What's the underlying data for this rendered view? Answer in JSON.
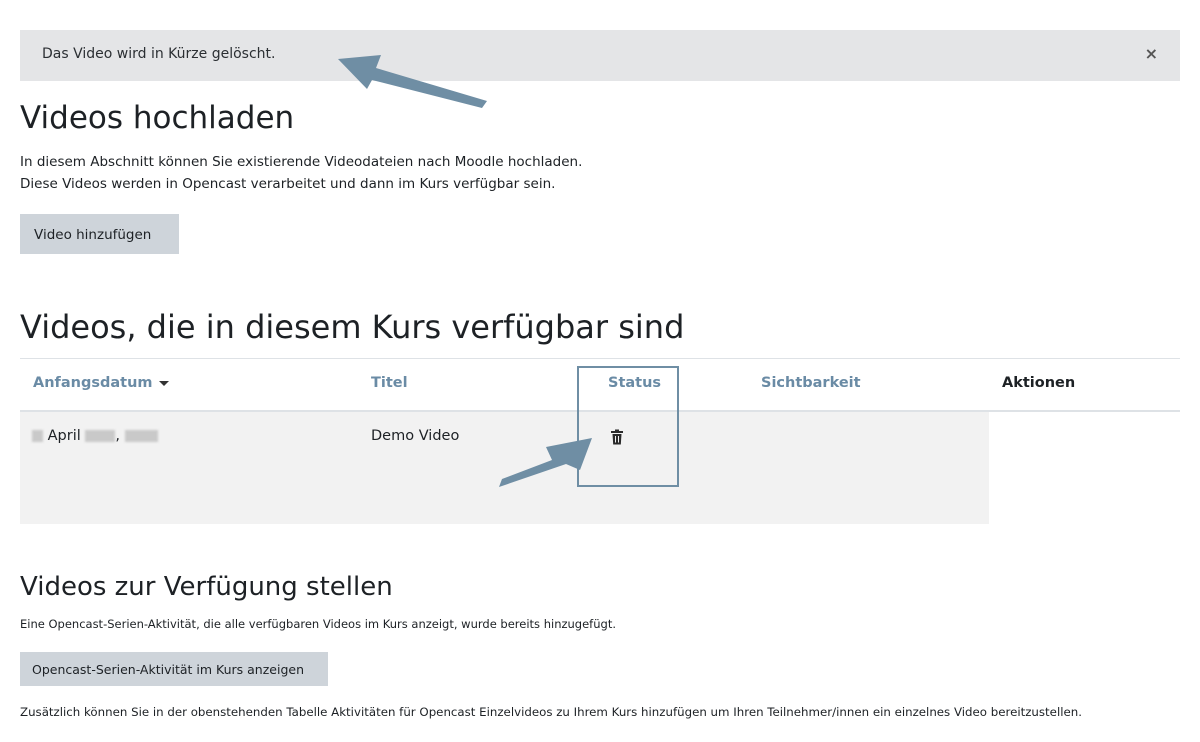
{
  "alert": {
    "text": "Das Video wird in Kürze gelöscht.",
    "close_symbol": "×"
  },
  "upload": {
    "heading": "Videos hochladen",
    "line1": "In diesem Abschnitt können Sie existierende Videodateien nach Moodle hochladen.",
    "line2": "Diese Videos werden in Opencast verarbeitet und dann im Kurs verfügbar sein.",
    "add_button": "Video hinzufügen"
  },
  "available": {
    "heading": "Videos, die in diesem Kurs verfügbar sind",
    "columns": [
      "Anfangsdatum",
      "Titel",
      "Status",
      "Sichtbarkeit",
      "Aktionen"
    ],
    "rows": [
      {
        "date_month": "April",
        "title": "Demo Video",
        "status_icon": "trash-icon"
      }
    ]
  },
  "provide": {
    "heading": "Videos zur Verfügung stellen",
    "text": "Eine Opencast-Serien-Aktivität, die alle verfügbaren Videos im Kurs anzeigt, wurde bereits hinzugefügt.",
    "button": "Opencast-Serien-Aktivität im Kurs anzeigen",
    "footer": "Zusätzlich können Sie in der obenstehenden Tabelle Aktivitäten für Opencast Einzelvideos zu Ihrem Kurs hinzufügen um Ihren Teilnehmer/innen ein einzelnes Video bereitzustellen."
  },
  "colors": {
    "link": "#6a8ba5",
    "annotation": "#6f8ea4",
    "alert_bg": "#e4e5e7",
    "button_bg": "#ced4da"
  }
}
